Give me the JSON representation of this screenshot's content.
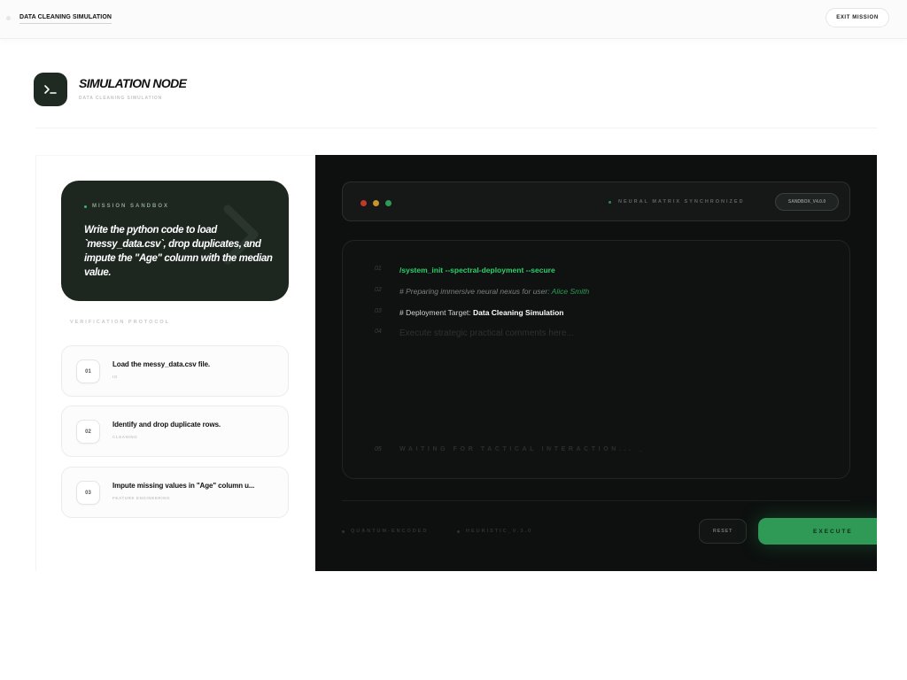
{
  "topbar": {
    "title": "DATA CLEANING SIMULATION",
    "exit_label": "EXIT MISSION"
  },
  "header": {
    "icon": "terminal-prompt-icon",
    "title": "SIMULATION NODE",
    "subtitle": "DATA CLEANING SIMULATION"
  },
  "mission": {
    "label": "MISSION SANDBOX",
    "text": "Write the python code to load `messy_data.csv`, drop duplicates, and impute the \"Age\" column with the median value."
  },
  "protocol": {
    "label": "VERIFICATION PROTOCOL",
    "tasks": [
      {
        "num": "01",
        "title": "Load the messy_data.csv file.",
        "tag": "IO"
      },
      {
        "num": "02",
        "title": "Identify and drop duplicate rows.",
        "tag": "CLEANING"
      },
      {
        "num": "03",
        "title": "Impute missing values in \"Age\" column u...",
        "tag": "FEATURE ENGINEERING"
      }
    ]
  },
  "terminal": {
    "status": "NEURAL MATRIX SYNCHRONIZED",
    "badge": "SANDBOX_V4.0.0",
    "lights": [
      "#c0392b",
      "#c9952b",
      "#2e9a57"
    ],
    "lines": [
      {
        "num": "01",
        "text": "/system_init --spectral-deployment --secure"
      },
      {
        "num": "02",
        "prefix": "# Preparing immersive neural nexus for user: ",
        "user": "Alice Smith"
      },
      {
        "num": "03",
        "prefix": "# Deployment Target: ",
        "target": "Data Cleaning Simulation"
      },
      {
        "num": "04",
        "placeholder": "Execute strategic practical comments here..."
      },
      {
        "num": "05",
        "text": "WAITING FOR TACTICAL INTERACTION... _"
      }
    ],
    "footer": {
      "left1": "QUANTUM-ENCODED",
      "left2": "HEURISTIC_V.3.0",
      "reset_label": "RESET",
      "execute_label": "EXECUTE"
    }
  }
}
